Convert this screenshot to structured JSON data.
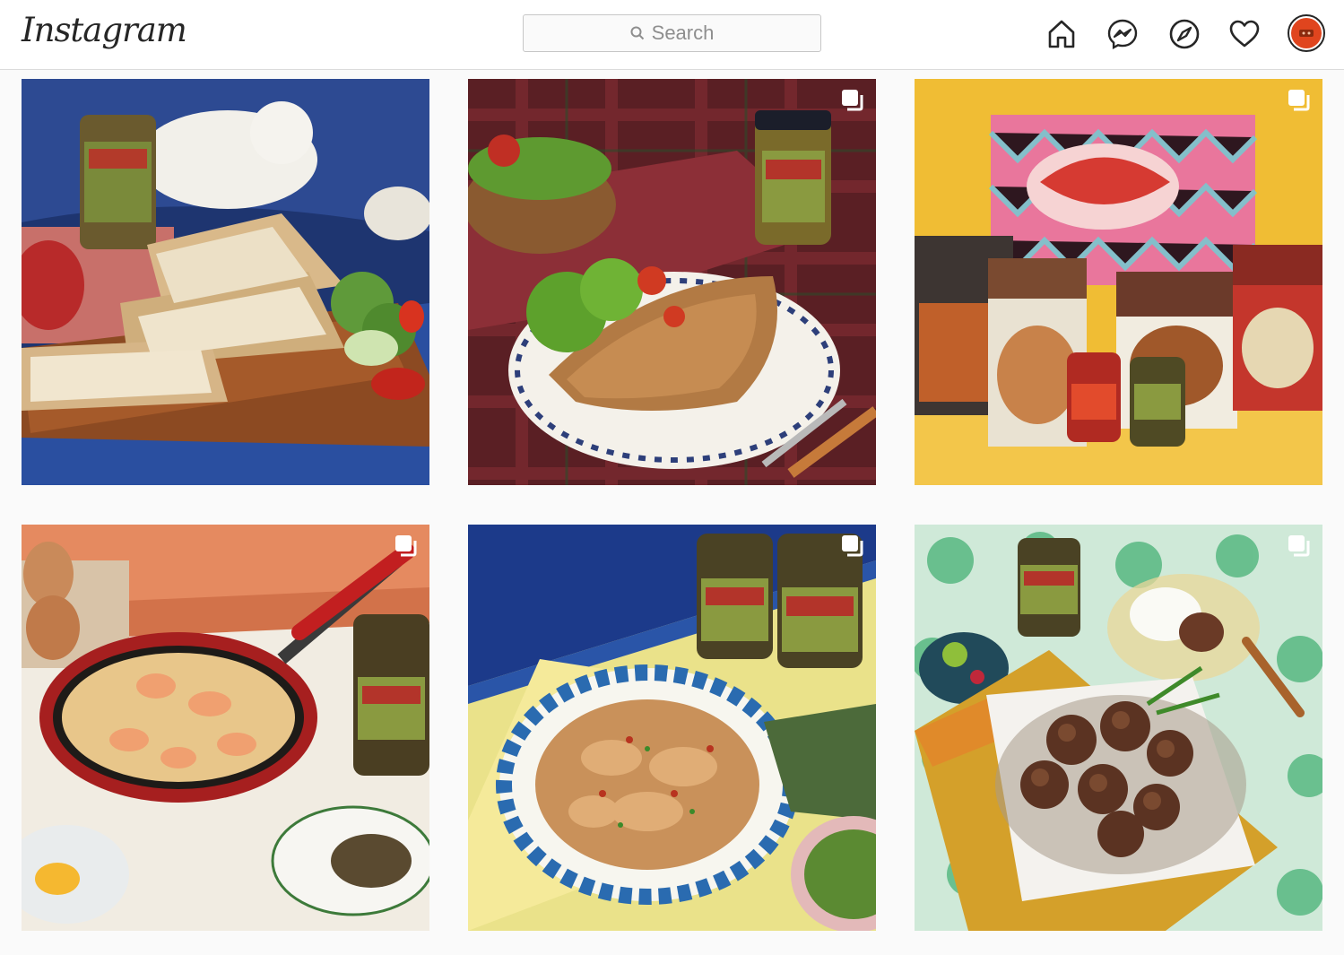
{
  "app": {
    "logo": "Instagram"
  },
  "search": {
    "placeholder": "Search"
  },
  "nav": [
    {
      "name": "home-icon"
    },
    {
      "name": "messenger-icon"
    },
    {
      "name": "explore-icon"
    },
    {
      "name": "activity-heart-icon"
    },
    {
      "name": "profile-avatar"
    }
  ],
  "colors": {
    "topbar": "#ffffff",
    "page": "#fafafa",
    "avatar": "#e0451e",
    "border": "#dbdbdb"
  },
  "posts": [
    {
      "id": "post-1",
      "multi": false,
      "subject": "grilled sandwiches with fish paste jar"
    },
    {
      "id": "post-2",
      "multi": true,
      "subject": "grilled chicken breast with salad and jar"
    },
    {
      "id": "post-3",
      "multi": true,
      "subject": "Promptkin product boxes and jars"
    },
    {
      "id": "post-4",
      "multi": true,
      "subject": "shrimp fried rice in red pan"
    },
    {
      "id": "post-5",
      "multi": true,
      "subject": "stir-fried chicken on patterned plate"
    },
    {
      "id": "post-6",
      "multi": true,
      "subject": "fried meatballs on paper with rice"
    }
  ]
}
